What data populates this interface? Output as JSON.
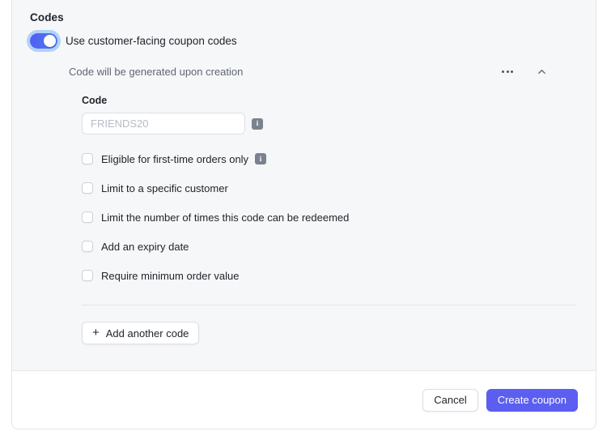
{
  "section": {
    "title": "Codes"
  },
  "toggle": {
    "label": "Use customer-facing coupon codes",
    "state": "on",
    "accent_color": "#4f5ef0",
    "focus_ring_color": "#60a5fa"
  },
  "nested": {
    "hint": "Code will be generated upon creation",
    "more_icon": "ellipsis-icon",
    "collapse_icon": "chevron-up-icon"
  },
  "code_field": {
    "label": "Code",
    "value": "",
    "placeholder": "FRIENDS20",
    "info_icon": "info-icon",
    "info_glyph": "i"
  },
  "options": [
    {
      "label": "Eligible for first-time orders only",
      "checked": false,
      "has_info": true,
      "info_glyph": "i"
    },
    {
      "label": "Limit to a specific customer",
      "checked": false,
      "has_info": false
    },
    {
      "label": "Limit the number of times this code can be redeemed",
      "checked": false,
      "has_info": false
    },
    {
      "label": "Add an expiry date",
      "checked": false,
      "has_info": false
    },
    {
      "label": "Require minimum order value",
      "checked": false,
      "has_info": false
    }
  ],
  "add_another": {
    "label": "Add another code",
    "icon": "plus-icon",
    "icon_glyph": "+"
  },
  "footer": {
    "cancel_label": "Cancel",
    "submit_label": "Create coupon",
    "submit_color": "#5b5ef0"
  }
}
